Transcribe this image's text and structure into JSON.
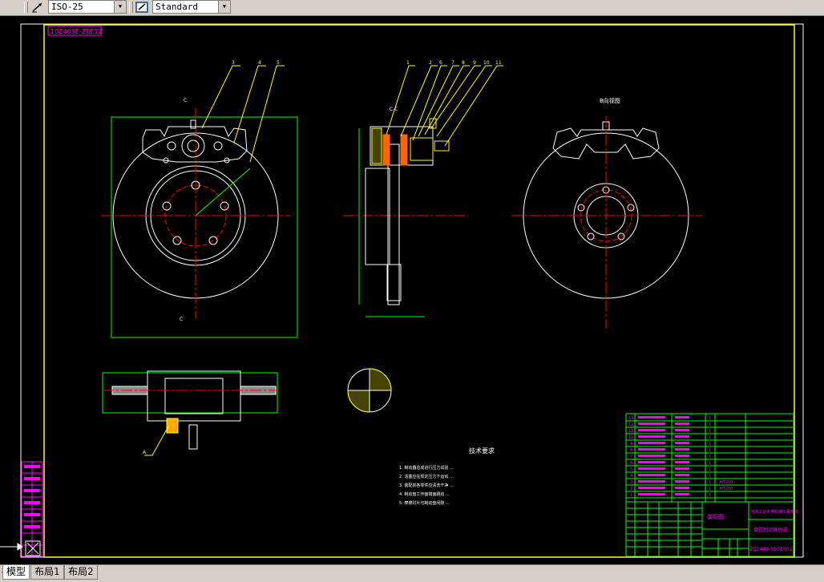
{
  "toolbar": {
    "dimstyle_value": "ISO-25",
    "textstyle_value": "Standard",
    "dimstyle_icon": "dimension-style-icon",
    "textstyle_icon": "text-style-icon"
  },
  "drawing": {
    "stamp_text": "10Z40SE-Z0E1Z",
    "section_label_top": "C",
    "section_label_bottom": "C",
    "side_view_label": "C-C",
    "right_view_title": "B向视图",
    "detail_label": "A",
    "tech_req_title": "技术要求",
    "tech_req_lines": [
      "1. 制动器总成进行压力试验 ...",
      "2. 活塞应在规定压力下运动 ...",
      "3. 装配前各零件应清洗干净 ...",
      "4. 制动盘工作面端面跳动 ...",
      "5. 摩擦衬片与制动盘间隙 ..."
    ],
    "balloons_front": [
      "3",
      "4",
      "5"
    ],
    "balloons_side": [
      "1",
      "2",
      "6",
      "7",
      "8",
      "9",
      "10",
      "11"
    ]
  },
  "bom": {
    "rows": [
      {
        "no": "13",
        "qty": "1"
      },
      {
        "no": "12",
        "qty": "1"
      },
      {
        "no": "11",
        "qty": "1"
      },
      {
        "no": "10",
        "qty": "1"
      },
      {
        "no": "9",
        "qty": "1"
      },
      {
        "no": "8",
        "qty": "1"
      },
      {
        "no": "7",
        "qty": "1"
      },
      {
        "no": "6",
        "qty": "1"
      },
      {
        "no": "5",
        "qty": "1"
      },
      {
        "no": "4",
        "qty": "1"
      },
      {
        "no": "3",
        "qty": "1"
      },
      {
        "no": "2",
        "qty": "1"
      },
      {
        "no": "1",
        "qty": "1"
      }
    ],
    "materials": [
      "HT250",
      "HT250"
    ],
    "drawing_number": "ZQ1489-3501001",
    "title_name": "盘式制动器总成",
    "school": "河南工业大学机械工程学院",
    "sheet_label": "装配图"
  },
  "tabs": {
    "model": "模型",
    "layout1": "布局1",
    "layout2": "布局2"
  },
  "colors": {
    "frame": "#ffff00",
    "outline": "#ffffff",
    "center": "#ff0000",
    "dimension": "#00ff00",
    "title_block": "#ff00ff",
    "magenta_border": "#ff00ff"
  }
}
